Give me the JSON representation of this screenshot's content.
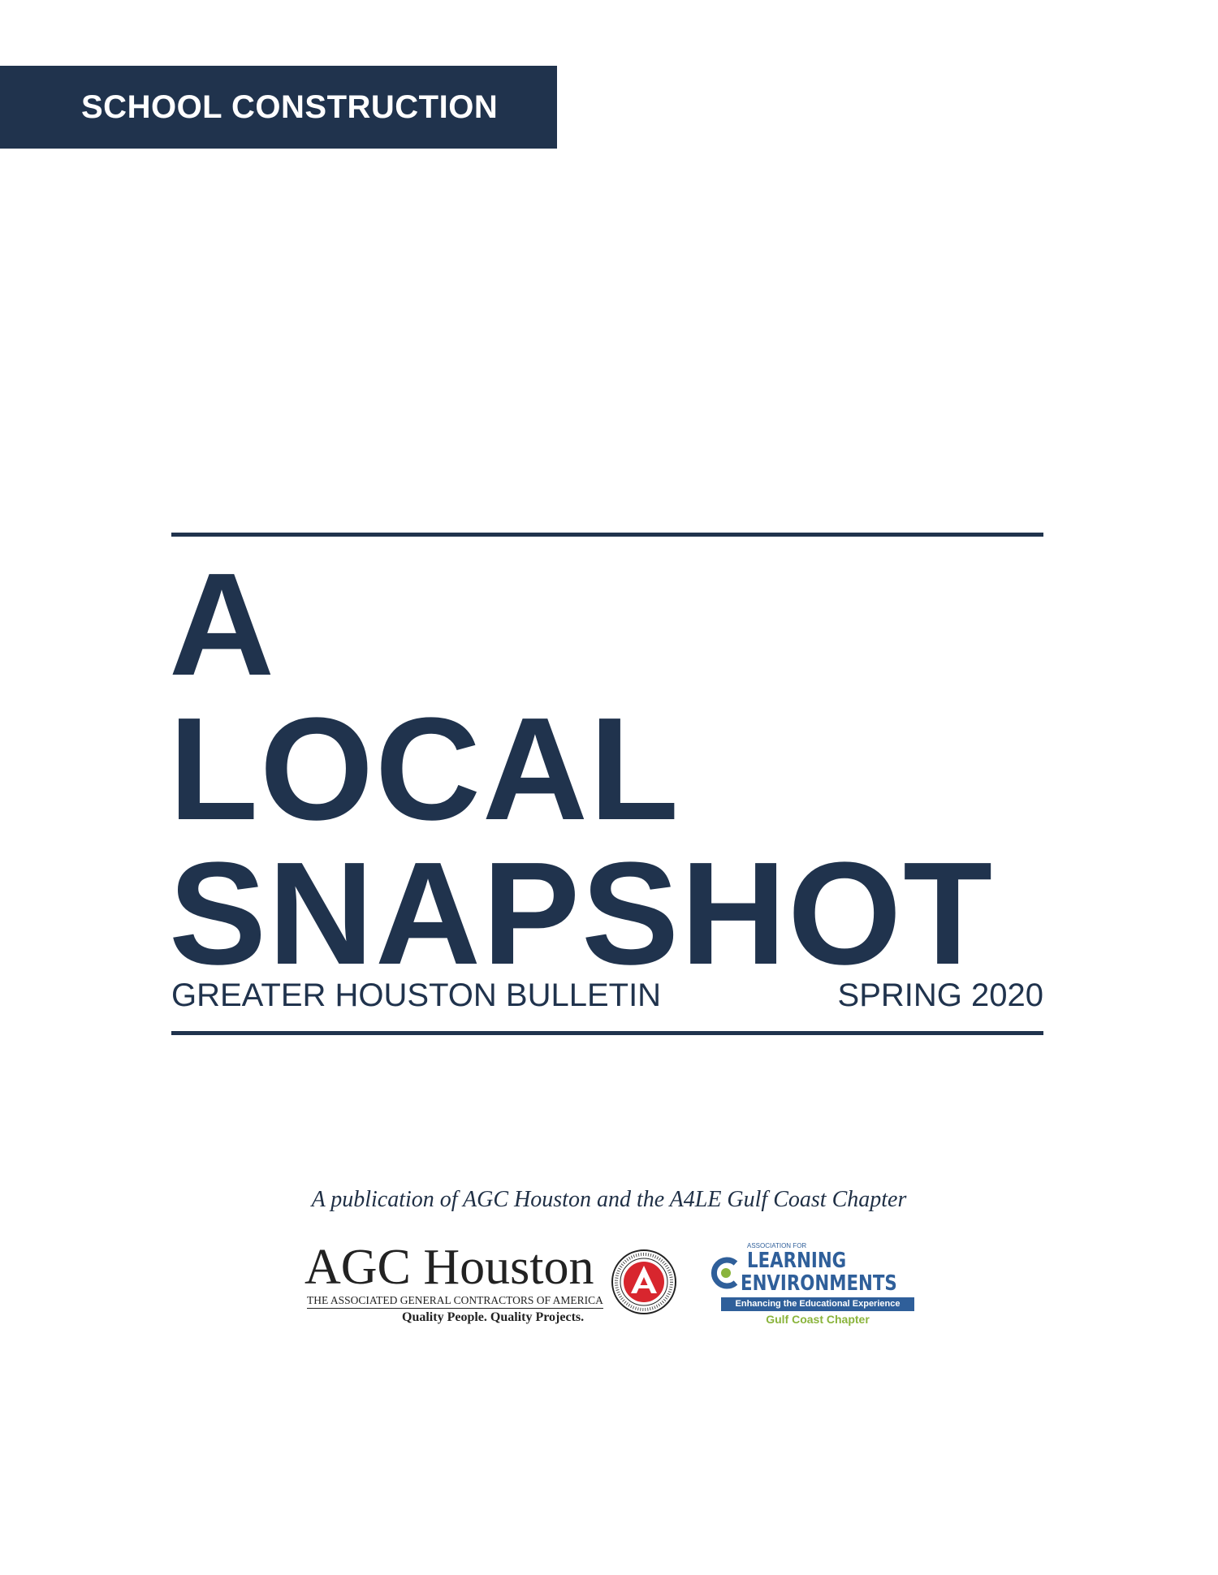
{
  "banner": {
    "label": "SCHOOL CONSTRUCTION"
  },
  "title": {
    "line1": "A",
    "line2": "LOCAL",
    "line3": "SNAPSHOT"
  },
  "subtitle": {
    "left": "GREATER HOUSTON BULLETIN",
    "right": "SPRING 2020"
  },
  "publication_note": "A publication of AGC Houston and the A4LE Gulf Coast Chapter",
  "agc_logo": {
    "name": "AGC Houston",
    "subtitle": "THE ASSOCIATED GENERAL CONTRACTORS OF AMERICA",
    "tagline": "Quality People. Quality Projects.",
    "seal_text": "THE ASSOCIATED GENERAL CONTRACTORS OF AMERICA"
  },
  "a4le_logo": {
    "association": "ASSOCIATION FOR",
    "learning": "LEARNING",
    "environments": "ENVIRONMENTS",
    "band": "Enhancing the Educational Experience",
    "chapter": "Gulf Coast Chapter"
  },
  "colors": {
    "navy": "#20334d",
    "a4le_blue": "#2f5f9a",
    "a4le_green": "#8ab43c",
    "agc_red": "#d8262e"
  }
}
